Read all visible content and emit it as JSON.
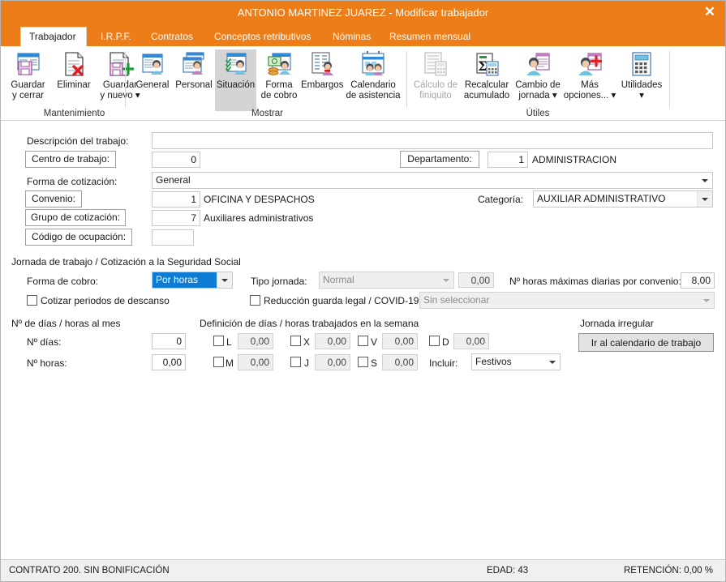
{
  "window": {
    "title": "ANTONIO MARTINEZ JUAREZ - Modificar trabajador",
    "close_label": "✕",
    "accent_color": "#ED7D19"
  },
  "tabs": [
    {
      "label": "Trabajador",
      "active": true
    },
    {
      "label": "I.R.P.F.",
      "active": false
    },
    {
      "label": "Contratos",
      "active": false
    },
    {
      "label": "Conceptos retributivos",
      "active": false
    },
    {
      "label": "Nóminas",
      "active": false
    },
    {
      "label": "Resumen mensual",
      "active": false
    }
  ],
  "ribbon": {
    "groups": [
      {
        "label": "Mantenimiento"
      },
      {
        "label": "Mostrar"
      },
      {
        "label": "Útiles"
      }
    ],
    "items": [
      {
        "label": "Guardar\ny cerrar",
        "icon": "save-close-icon",
        "state": "normal"
      },
      {
        "label": "Eliminar",
        "icon": "delete-icon",
        "state": "normal"
      },
      {
        "label": "Guardar\ny nuevo ▾",
        "icon": "save-new-icon",
        "state": "normal"
      },
      {
        "label": "General",
        "icon": "general-icon",
        "state": "normal"
      },
      {
        "label": "Personal",
        "icon": "personal-icon",
        "state": "normal"
      },
      {
        "label": "Situación",
        "icon": "situacion-icon",
        "state": "selected"
      },
      {
        "label": "Forma\nde cobro",
        "icon": "forma-cobro-icon",
        "state": "normal"
      },
      {
        "label": "Embargos",
        "icon": "embargos-icon",
        "state": "normal"
      },
      {
        "label": "Calendario\nde asistencia",
        "icon": "calendario-icon",
        "state": "normal"
      },
      {
        "label": "Cálculo de\nfiniquito",
        "icon": "calculo-finiquito-icon",
        "state": "disabled"
      },
      {
        "label": "Recalcular\nacumulado",
        "icon": "recalcular-icon",
        "state": "normal"
      },
      {
        "label": "Cambio de\njornada ▾",
        "icon": "cambio-jornada-icon",
        "state": "normal"
      },
      {
        "label": "Más\nopciones... ▾",
        "icon": "mas-opciones-icon",
        "state": "normal"
      },
      {
        "label": "Utilidades\n▾",
        "icon": "utilidades-icon",
        "state": "normal"
      }
    ]
  },
  "form": {
    "descripcion_label": "Descripción del trabajo:",
    "descripcion_value": "",
    "centro_label": "Centro de trabajo:",
    "centro_value": "0",
    "departamento_label": "Departamento:",
    "departamento_code": "1",
    "departamento_name": "ADMINISTRACION",
    "forma_cotizacion_label": "Forma de cotización:",
    "forma_cotizacion_value": "General",
    "convenio_label": "Convenio:",
    "convenio_code": "1",
    "convenio_name": "OFICINA Y DESPACHOS",
    "categoria_label": "Categoría:",
    "categoria_value": "AUXILIAR ADMINISTRATIVO",
    "grupo_cotizacion_label": "Grupo de cotización:",
    "grupo_cotizacion_code": "7",
    "grupo_cotizacion_name": "Auxiliares administrativos",
    "codigo_ocupacion_label": "Código de ocupación:",
    "codigo_ocupacion_value": ""
  },
  "jornada": {
    "section_label": "Jornada de trabajo / Cotización a la Seguridad Social",
    "forma_cobro_label": "Forma de cobro:",
    "forma_cobro_value": "Por horas",
    "cotizar_descanso_label": "Cotizar periodos de descanso",
    "cotizar_descanso_checked": false,
    "tipo_jornada_label": "Tipo jornada:",
    "tipo_jornada_value": "Normal",
    "tipo_jornada_pct": "0,00",
    "reduccion_label": "Reducción guarda legal / COVID-19",
    "reduccion_checked": false,
    "reduccion_combo_value": "Sin seleccionar",
    "horas_max_label": "Nº horas máximas diarias por convenio:",
    "horas_max_value": "8,00"
  },
  "mes": {
    "section_label": "Nº de días / horas al mes",
    "dias_label": "Nº días:",
    "dias_value": "0",
    "horas_label": "Nº horas:",
    "horas_value": "0,00"
  },
  "semana": {
    "section_label": "Definición de días / horas trabajados en la semana",
    "days": [
      {
        "key": "L",
        "value": "0,00",
        "checked": false
      },
      {
        "key": "M",
        "value": "0,00",
        "checked": false
      },
      {
        "key": "X",
        "value": "0,00",
        "checked": false
      },
      {
        "key": "J",
        "value": "0,00",
        "checked": false
      },
      {
        "key": "V",
        "value": "0,00",
        "checked": false
      },
      {
        "key": "S",
        "value": "0,00",
        "checked": false
      },
      {
        "key": "D",
        "value": "0,00",
        "checked": false
      }
    ],
    "incluir_label": "Incluir:",
    "incluir_value": "Festivos"
  },
  "irregular": {
    "section_label": "Jornada irregular",
    "button_label": "Ir al calendario de trabajo"
  },
  "status": {
    "contrato": "CONTRATO 200.  SIN BONIFICACIÓN",
    "edad": "EDAD: 43",
    "retencion": "RETENCIÓN: 0,00 %"
  }
}
